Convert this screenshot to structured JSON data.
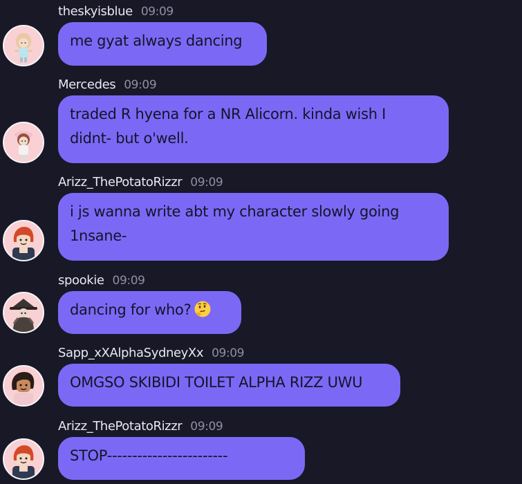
{
  "messages": [
    {
      "username": "theskyisblue",
      "time": "09:09",
      "text": "me gyat always dancing",
      "avatar": "avatar-girl-icon"
    },
    {
      "username": "Mercedes",
      "time": "09:09",
      "text": "traded R hyena for a NR Alicorn. kinda wish I\ndidnt- but o'well.",
      "avatar": "avatar-hat-girl-icon"
    },
    {
      "username": "Arizz_ThePotatoRizzr",
      "time": "09:09",
      "text": "i js wanna write abt my character slowly going\n1nsane-",
      "avatar": "avatar-redhead-icon"
    },
    {
      "username": "spookie",
      "time": "09:09",
      "text": "dancing for who?",
      "avatar": "avatar-witch-icon",
      "emoji": "thinking-face-icon"
    },
    {
      "username": "Sapp_xXAlphaSydneyXx",
      "time": "09:09",
      "text": "OMGSO SKIBIDI TOILET ALPHA RIZZ UWU",
      "avatar": "avatar-dark-hair-icon"
    },
    {
      "username": "Arizz_ThePotatoRizzr",
      "time": "09:09",
      "text": "STOP------------------------",
      "avatar": "avatar-redhead-icon"
    }
  ],
  "colors": {
    "background": "#181827",
    "bubble": "#7b69f6",
    "bubble_text": "#141428",
    "username": "#e9e9f2",
    "timestamp": "#8f8fa3",
    "avatar_bg": "#f9d0d3"
  }
}
